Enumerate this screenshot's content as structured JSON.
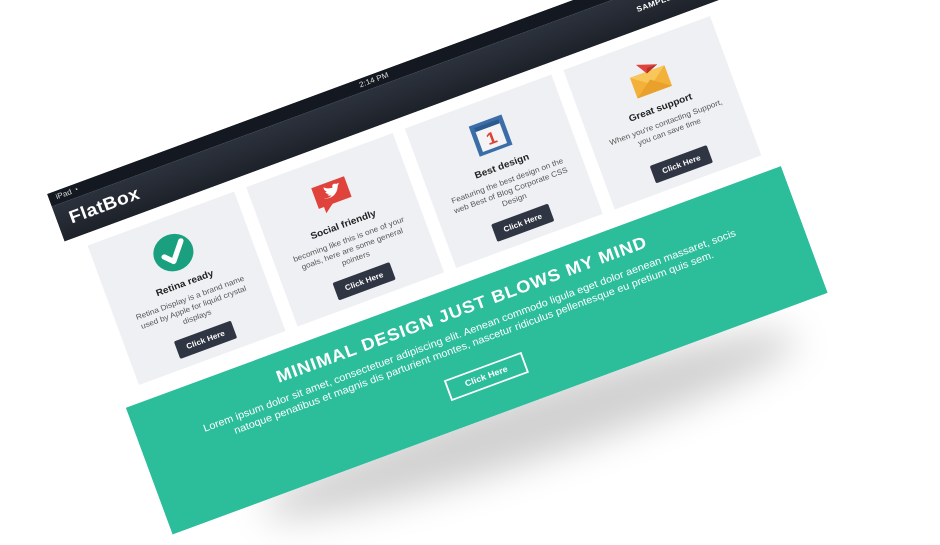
{
  "status_bar": {
    "device": "iPad",
    "wifi_icon": "wifi-icon",
    "time": "2:14 PM"
  },
  "navbar": {
    "brand": "FlatBox",
    "link": "SAMPLE PAGE"
  },
  "cards": [
    {
      "icon": "checkmark-icon",
      "title": "Retina ready",
      "text": "Retina Display is a brand name used by Apple for liquid crystal displays",
      "button": "Click Here"
    },
    {
      "icon": "twitter-bird-icon",
      "title": "Social friendly",
      "text": "becoming like this is one of your goals, here are some general pointers",
      "button": "Click Here"
    },
    {
      "icon": "calendar-icon",
      "title": "Best design",
      "text": "Featuring the best design on the web Best of Blog Corporate CSS Design",
      "button": "Click Here",
      "badge": "1"
    },
    {
      "icon": "paper-plane-envelope-icon",
      "title": "Great support",
      "text": "When you're contacting Support, you can save time",
      "button": "Click Here"
    }
  ],
  "hero": {
    "title": "MINIMAL DESIGN JUST BLOWS MY MIND",
    "text": "Lorem ipsum dolor sit amet, consectetuer adipiscing elit. Aenean commodo ligula eget dolor aenean massaret, socis natoque penatibus et magnis dis parturient montes, nascetur ridiculus pellentesque eu pretium quis sem.",
    "button": "Click Here"
  },
  "colors": {
    "accent": "#2cbd9b",
    "navbar": "#1d2129",
    "card_bg": "#eef0f3",
    "button": "#2f3542"
  }
}
